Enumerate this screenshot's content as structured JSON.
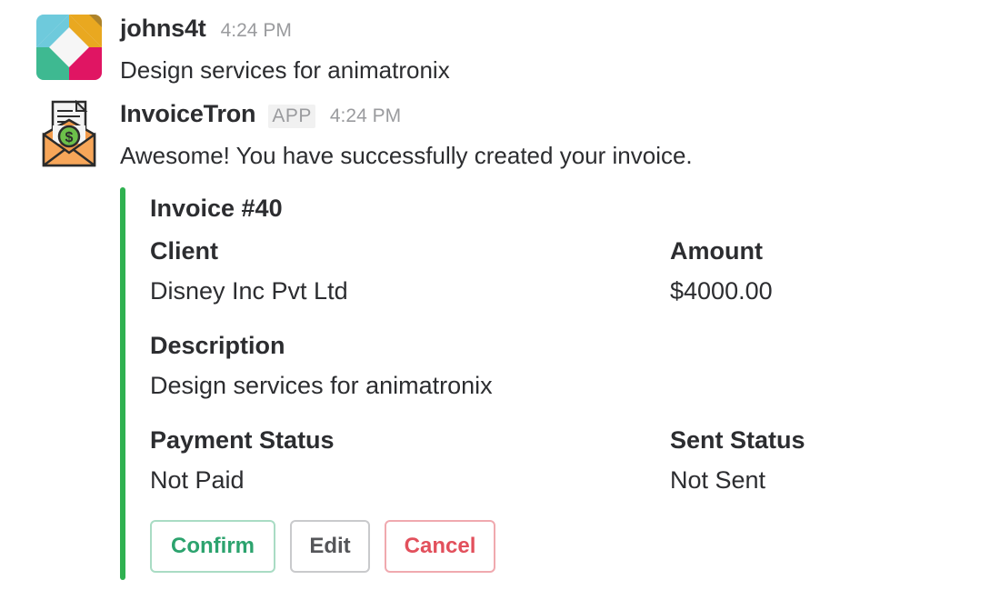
{
  "messages": [
    {
      "username": "johns4t",
      "timestamp": "4:24 PM",
      "text": "Design services for animatronix",
      "avatar_icon": "slack-diamond-logo-avatar"
    },
    {
      "username": "InvoiceTron",
      "badge": "APP",
      "timestamp": "4:24 PM",
      "text": "Awesome! You have successfully created your invoice.",
      "avatar_icon": "invoice-envelope-dollar-icon"
    }
  ],
  "attachment": {
    "bar_color": "#2fb150",
    "title": "Invoice #40",
    "fields": {
      "client": {
        "label": "Client",
        "value": "Disney Inc Pvt Ltd"
      },
      "amount": {
        "label": "Amount",
        "value": "$4000.00"
      },
      "description": {
        "label": "Description",
        "value": "Design services for animatronix"
      },
      "payment_status": {
        "label": "Payment Status",
        "value": "Not Paid"
      },
      "sent_status": {
        "label": "Sent Status",
        "value": "Not Sent"
      }
    },
    "actions": {
      "confirm": "Confirm",
      "edit": "Edit",
      "cancel": "Cancel"
    }
  },
  "colors": {
    "confirm": "#2ca36e",
    "cancel": "#e2505c",
    "text": "#2c2d30",
    "muted": "#9a9b9e"
  }
}
